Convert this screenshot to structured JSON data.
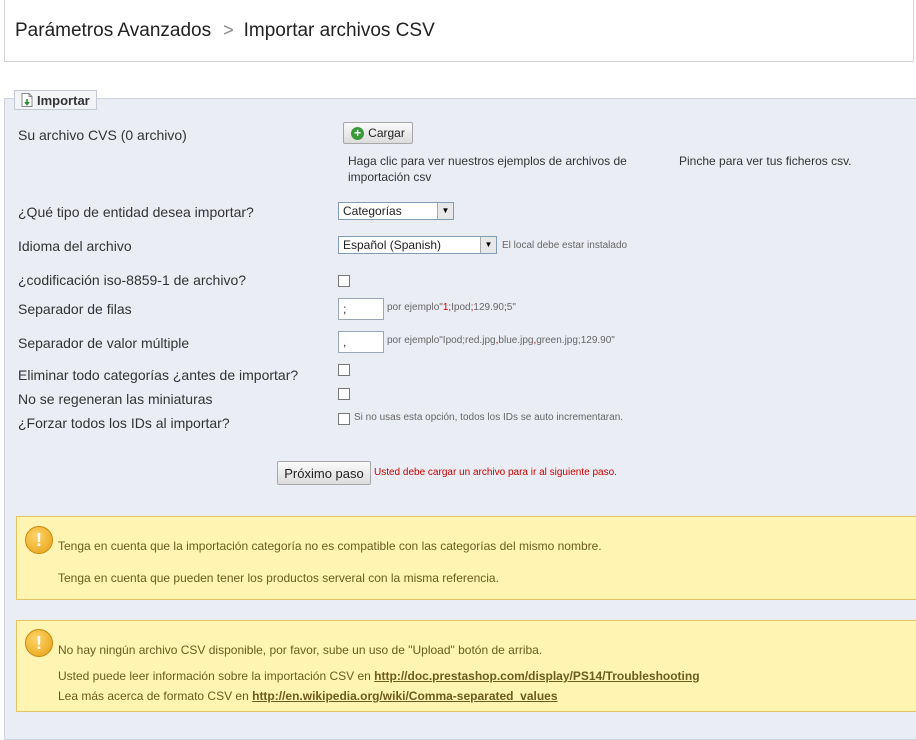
{
  "breadcrumb": {
    "parent": "Parámetros Avanzados",
    "separator": ">",
    "current": "Importar archivos CSV"
  },
  "fieldset": {
    "legend": "Importar"
  },
  "file": {
    "label": "Su archivo CVS (0 archivo)",
    "upload_button": "Cargar",
    "examples_help": "Haga clic para ver nuestros ejemplos de archivos de importación csv",
    "files_help": "Pinche para ver tus ficheros csv."
  },
  "entity": {
    "label": "¿Qué tipo de entidad desea importar?",
    "value": "Categorías"
  },
  "language": {
    "label": "Idioma del archivo",
    "value": "Español (Spanish)",
    "note": "El local debe estar instalado"
  },
  "iso": {
    "label": "¿codificación iso-8859-1 de archivo?",
    "checked": false
  },
  "row_separator": {
    "label": "Separador de filas",
    "value": ";",
    "note_prefix": "por ejemplo\"",
    "note_parts": [
      "1",
      ";",
      "Ipod",
      ";",
      "129.90",
      ";",
      "5\""
    ]
  },
  "multi_separator": {
    "label": "Separador de valor múltiple",
    "value": ",",
    "note_prefix": "por ejemplo\"Ipod;red.jpg",
    "note_parts": [
      ",",
      "blue.jpg",
      ",",
      "green.jpg;129.90\""
    ]
  },
  "delete_all": {
    "label": "Eliminar todo categorías ¿antes de importar?",
    "checked": false
  },
  "no_regen": {
    "label": "No se regeneran las miniaturas",
    "checked": false
  },
  "force_ids": {
    "label": "¿Forzar todos los IDs al importar?",
    "checked": false,
    "note": "Si no usas esta opción, todos los IDs se auto incrementaran."
  },
  "next": {
    "button": "Próximo paso",
    "error": "Usted debe cargar un archivo para ir al siguiente paso."
  },
  "warning1": {
    "line1": "Tenga en cuenta que la importación categoría no es compatible con las categorías del mismo nombre.",
    "line2": "Tenga en cuenta que pueden tener los productos serveral con la misma referencia."
  },
  "warning2": {
    "line1": "No hay ningún archivo CSV disponible, por favor, sube un uso de \"Upload\" botón de arriba.",
    "line2_prefix": "Usted puede leer información sobre la importación CSV en ",
    "line2_link": "http://doc.prestashop.com/display/PS14/Troubleshooting",
    "line3_prefix": "Lea más acerca de formato CSV en ",
    "line3_link": "http://en.wikipedia.org/wiki/Comma-separated_values"
  },
  "colors": {
    "panel_bg": "#ebedf4",
    "warning_bg": "#fff4b1",
    "warning_border": "#e2c460",
    "error_red": "#cc0000"
  }
}
